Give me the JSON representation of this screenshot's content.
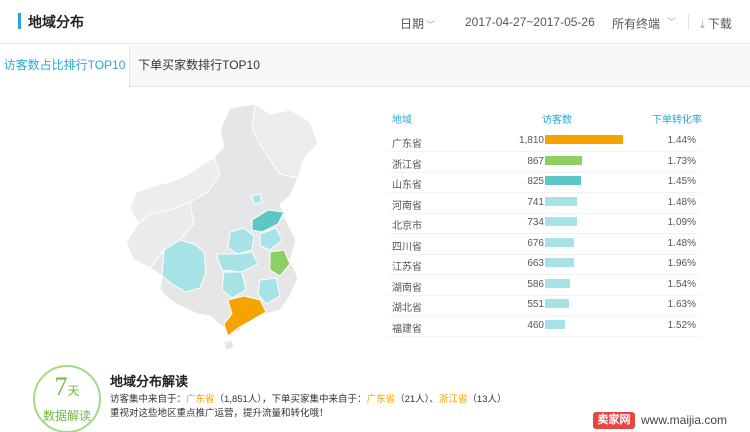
{
  "header": {
    "title": "地域分布",
    "date_label": "日期",
    "date_range": "2017-04-27~2017-05-26",
    "device_label": "所有终端",
    "download_label": "下载"
  },
  "tabs": [
    {
      "label": "访客数占比排行TOP10",
      "active": true
    },
    {
      "label": "下单买家数排行TOP10",
      "active": false
    }
  ],
  "table": {
    "col_region": "地域",
    "col_visitors": "访客数",
    "col_rate": "下单转化率",
    "rows": [
      {
        "province": "广东省",
        "visitors": "1,810",
        "value": 1810,
        "rate": "1.44%",
        "color": "#f5a300"
      },
      {
        "province": "浙江省",
        "visitors": "867",
        "value": 867,
        "rate": "1.73%",
        "color": "#8ccf63"
      },
      {
        "province": "山东省",
        "visitors": "825",
        "value": 825,
        "rate": "1.45%",
        "color": "#5fc6c8"
      },
      {
        "province": "河南省",
        "visitors": "741",
        "value": 741,
        "rate": "1.48%",
        "color": "#a7e3e6"
      },
      {
        "province": "北京市",
        "visitors": "734",
        "value": 734,
        "rate": "1.09%",
        "color": "#a7e3e6"
      },
      {
        "province": "四川省",
        "visitors": "676",
        "value": 676,
        "rate": "1.48%",
        "color": "#a7e3e6"
      },
      {
        "province": "江苏省",
        "visitors": "663",
        "value": 663,
        "rate": "1.96%",
        "color": "#a7e3e6"
      },
      {
        "province": "湖南省",
        "visitors": "586",
        "value": 586,
        "rate": "1.54%",
        "color": "#a7e3e6"
      },
      {
        "province": "湖北省",
        "visitors": "551",
        "value": 551,
        "rate": "1.63%",
        "color": "#a7e3e6"
      },
      {
        "province": "福建省",
        "visitors": "460",
        "value": 460,
        "rate": "1.52%",
        "color": "#a7e3e6"
      }
    ]
  },
  "summary": {
    "days_number": "7",
    "days_unit": "天",
    "circle_label": "数据解读",
    "title": "地域分布解读",
    "line1_a": "访客集中来自于：",
    "line1_hl1": "广东省",
    "line1_b": "（1,851人），下单买家集中来自于：",
    "line1_hl2": "广东省",
    "line1_c": "（21人）、",
    "line1_hl3": "浙江省",
    "line1_d": "（13人）",
    "line2": "重视对这些地区重点推广运营，提升流量和转化哦！"
  },
  "watermark": {
    "badge": "卖家网",
    "url": "www.maijia.com"
  }
}
